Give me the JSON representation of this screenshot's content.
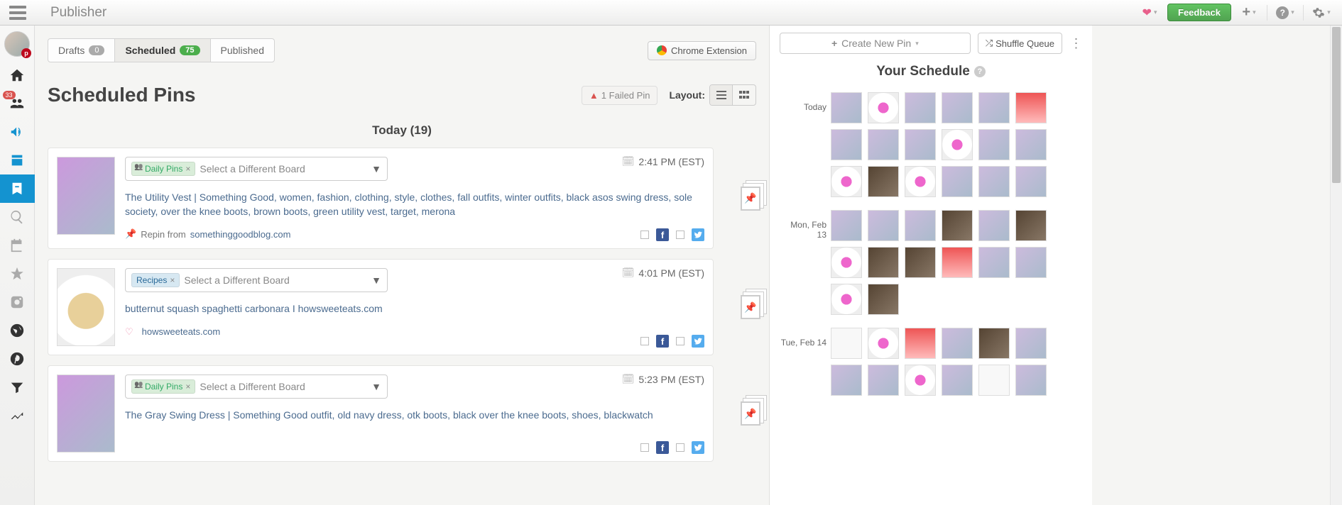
{
  "topbar": {
    "title": "Publisher",
    "feedback": "Feedback"
  },
  "left_rail": {
    "community_badge": "33"
  },
  "tabs": {
    "drafts_label": "Drafts",
    "drafts_count": "0",
    "scheduled_label": "Scheduled",
    "scheduled_count": "75",
    "published_label": "Published",
    "chrome_ext": "Chrome Extension"
  },
  "page": {
    "title": "Scheduled Pins",
    "failed_warn": "▲",
    "failed_label": "1 Failed Pin",
    "layout_label": "Layout:",
    "day_header": "Today (19)"
  },
  "pins": [
    {
      "board_tag": "Daily Pins",
      "board_tag_class": "green",
      "board_select": "Select a Different Board",
      "time": "2:41 PM (EST)",
      "desc": "The Utility Vest | Something Good, women, fashion, clothing, style, clothes, fall outfits, winter outfits, black asos swing dress, sole society, over the knee boots, brown boots, green utility vest, target, merona",
      "source_prefix": "Repin from ",
      "source": "somethinggoodblog.com",
      "source_icon": "repin",
      "thumb_class": ""
    },
    {
      "board_tag": "Recipes",
      "board_tag_class": "blue",
      "board_select": "Select a Different Board",
      "time": "4:01 PM (EST)",
      "desc": "butternut squash spaghetti carbonara I howsweeteats.com",
      "source_prefix": "",
      "source": "howsweeteats.com",
      "source_icon": "heart",
      "thumb_class": "food"
    },
    {
      "board_tag": "Daily Pins",
      "board_tag_class": "green",
      "board_select": "Select a Different Board",
      "time": "5:23 PM (EST)",
      "desc": "The Gray Swing Dress | Something Good outfit, old navy dress, otk boots, black over the knee boots, shoes, blackwatch",
      "source_prefix": "",
      "source": "",
      "source_icon": "",
      "thumb_class": ""
    }
  ],
  "schedule": {
    "create": "Create New Pin",
    "shuffle": "Shuffle Queue",
    "title": "Your Schedule",
    "days": [
      {
        "label": "Today",
        "thumbs": [
          "",
          "food",
          "",
          "",
          "",
          "red",
          "",
          "",
          "",
          "food",
          "",
          "",
          "food",
          "dark",
          "food",
          "",
          "",
          ""
        ]
      },
      {
        "label": "Mon, Feb 13",
        "thumbs": [
          "",
          "",
          "",
          "dark",
          "",
          "dark",
          "food",
          "dark",
          "dark",
          "red",
          "",
          "",
          "food",
          "dark"
        ]
      },
      {
        "label": "Tue, Feb 14",
        "thumbs": [
          "white",
          "food",
          "red",
          "",
          "dark",
          "",
          "",
          "",
          "food",
          "",
          "white",
          ""
        ]
      }
    ]
  }
}
